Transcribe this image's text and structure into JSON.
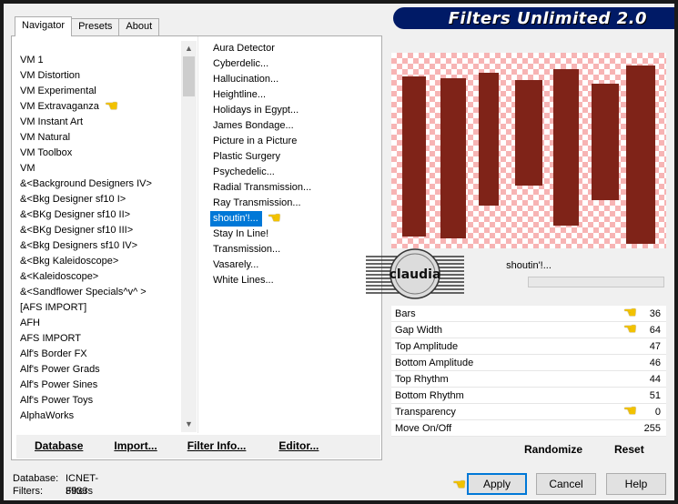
{
  "banner": {
    "title": "Filters Unlimited 2.0"
  },
  "tabs": [
    {
      "label": "Navigator",
      "active": true
    },
    {
      "label": "Presets",
      "active": false
    },
    {
      "label": "About",
      "active": false
    }
  ],
  "categories": [
    "VM 1",
    "VM Distortion",
    "VM Experimental",
    "VM Extravaganza",
    "VM Instant Art",
    "VM Natural",
    "VM Toolbox",
    "VM",
    "&<Background Designers IV>",
    "&<Bkg Designer sf10 I>",
    "&<BKg Designer sf10 II>",
    "&<BKg Designer sf10 III>",
    "&<Bkg Designers sf10 IV>",
    "&<Bkg Kaleidoscope>",
    "&<Kaleidoscope>",
    "&<Sandflower Specials^v^ >",
    "[AFS IMPORT]",
    "AFH",
    "AFS IMPORT",
    "Alf's Border FX",
    "Alf's Power Grads",
    "Alf's Power Sines",
    "Alf's Power Toys",
    "AlphaWorks"
  ],
  "selected_category_index": 3,
  "filters": [
    "Aura Detector",
    "Cyberdelic...",
    "Hallucination...",
    "Heightline...",
    "Holidays in Egypt...",
    "James Bondage...",
    "Picture in a Picture",
    "Plastic Surgery",
    "Psychedelic...",
    "Radial Transmission...",
    "Ray Transmission...",
    "shoutin'!...",
    "Stay In Line!",
    "Transmission...",
    "Vasarely...",
    "White Lines..."
  ],
  "selected_filter_index": 11,
  "left_buttons": {
    "database": "Database",
    "import": "Import...",
    "filter_info": "Filter Info...",
    "editor": "Editor..."
  },
  "filter_name": "shoutin'!...",
  "watermark_text": "claudia",
  "params": [
    {
      "label": "Bars",
      "value": "36",
      "pointer": true
    },
    {
      "label": "Gap Width",
      "value": "64",
      "pointer": true
    },
    {
      "label": "Top Amplitude",
      "value": "47",
      "pointer": false
    },
    {
      "label": "Bottom Amplitude",
      "value": "46",
      "pointer": false
    },
    {
      "label": "Top Rhythm",
      "value": "44",
      "pointer": false
    },
    {
      "label": "Bottom Rhythm",
      "value": "51",
      "pointer": false
    },
    {
      "label": "Transparency",
      "value": "0",
      "pointer": true
    },
    {
      "label": "Move On/Off",
      "value": "255",
      "pointer": false
    }
  ],
  "right_buttons": {
    "randomize": "Randomize",
    "reset": "Reset"
  },
  "status": {
    "database_label": "Database:",
    "database_value": "ICNET-Filters",
    "filters_label": "Filters:",
    "filters_value": "3933"
  },
  "dialog_buttons": {
    "apply": "Apply",
    "cancel": "Cancel",
    "help": "Help"
  },
  "colors": {
    "bar": "#7f2318",
    "checker": "#f7b4b4",
    "selection": "#0078d7",
    "banner": "#001a66",
    "pointer": "#f2c200"
  },
  "icons": {
    "pointer": "pointing-hand-icon"
  }
}
